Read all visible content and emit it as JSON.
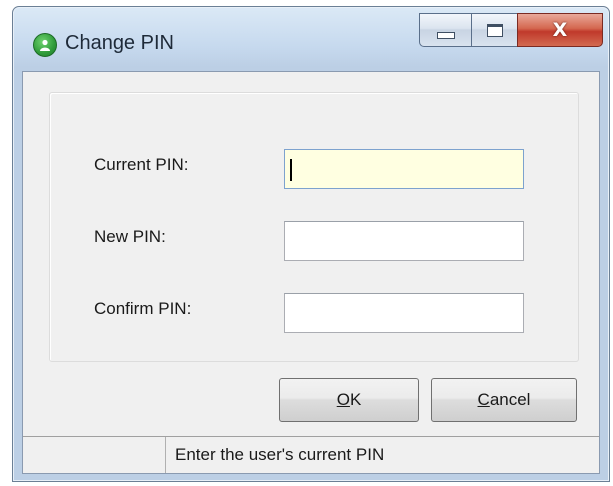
{
  "window": {
    "title": "Change PIN",
    "close_glyph": "X",
    "icon": "app-user-icon"
  },
  "form": {
    "current_pin_label": "Current PIN:",
    "current_pin_value": "",
    "new_pin_label": "New PIN:",
    "new_pin_value": "",
    "confirm_pin_label": "Confirm PIN:",
    "confirm_pin_value": ""
  },
  "buttons": {
    "ok_accel": "O",
    "ok_rest": "K",
    "cancel_accel": "C",
    "cancel_rest": "ancel"
  },
  "status": {
    "text": "Enter the user's current PIN"
  },
  "colors": {
    "focused_field_bg": "#ffffe1",
    "close_button": "#c0392b",
    "app_icon": "#2f9b3a"
  }
}
